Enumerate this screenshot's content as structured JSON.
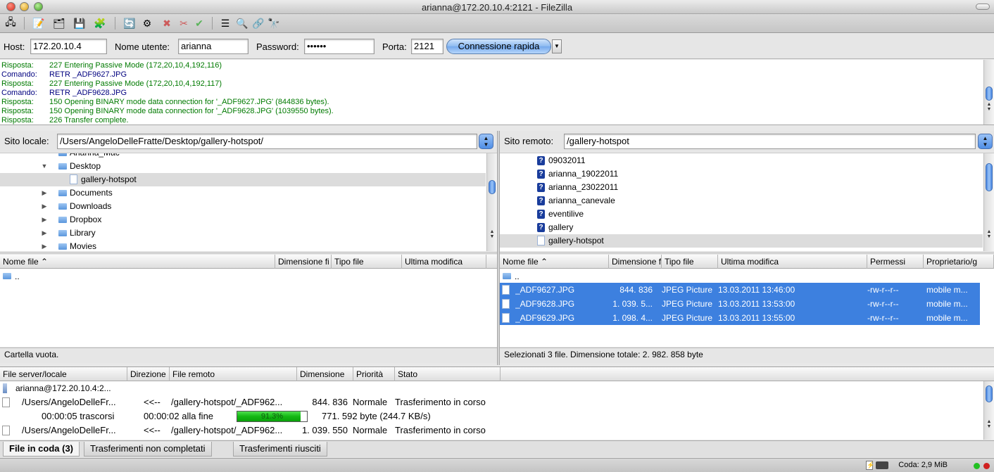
{
  "window": {
    "title": "arianna@172.20.10.4:2121 - FileZilla"
  },
  "toolbar": {
    "icons": [
      "site-manager-icon",
      "message-log-icon",
      "local-tree-icon",
      "remote-tree-icon",
      "transfer-queue-icon",
      "refresh-icon",
      "process-queue-icon",
      "cancel-icon",
      "disconnect-icon",
      "reconnect-icon",
      "filter-icon",
      "compare-icon",
      "sync-browse-icon",
      "search-icon"
    ]
  },
  "quickconnect": {
    "host_label": "Host:",
    "host_value": "172.20.10.4",
    "user_label": "Nome utente:",
    "user_value": "arianna",
    "password_label": "Password:",
    "password_value": "••••••",
    "port_label": "Porta:",
    "port_value": "2121",
    "connect_button": "Connessione rapida"
  },
  "log": [
    {
      "kind": "Risposta:",
      "type": "resp",
      "msg": "227 Entering Passive Mode (172,20,10,4,192,116)"
    },
    {
      "kind": "Comando:",
      "type": "cmd",
      "msg": "RETR _ADF9627.JPG"
    },
    {
      "kind": "Risposta:",
      "type": "resp",
      "msg": "227 Entering Passive Mode (172,20,10,4,192,117)"
    },
    {
      "kind": "Comando:",
      "type": "cmd",
      "msg": "RETR _ADF9628.JPG"
    },
    {
      "kind": "Risposta:",
      "type": "resp",
      "msg": "150 Opening BINARY mode data connection for '_ADF9627.JPG' (844836 bytes)."
    },
    {
      "kind": "Risposta:",
      "type": "resp",
      "msg": "150 Opening BINARY mode data connection for '_ADF9628.JPG' (1039550 bytes)."
    },
    {
      "kind": "Risposta:",
      "type": "resp",
      "msg": "226 Transfer complete."
    }
  ],
  "local": {
    "site_label": "Sito locale:",
    "path": "/Users/AngeloDelleFratte/Desktop/gallery-hotspot/",
    "tree": [
      {
        "name": "Arianna_Mac",
        "tri": "",
        "indent": 0
      },
      {
        "name": "Desktop",
        "tri": "▼",
        "indent": 0
      },
      {
        "name": "gallery-hotspot",
        "tri": "",
        "indent": 1,
        "selected": true
      },
      {
        "name": "Documents",
        "tri": "▶",
        "indent": 0
      },
      {
        "name": "Downloads",
        "tri": "▶",
        "indent": 0
      },
      {
        "name": "Dropbox",
        "tri": "▶",
        "indent": 0
      },
      {
        "name": "Library",
        "tri": "▶",
        "indent": 0
      },
      {
        "name": "Movies",
        "tri": "▶",
        "indent": 0
      }
    ],
    "columns": [
      "Nome file",
      "Dimensione fi",
      "Tipo file",
      "Ultima modifica"
    ],
    "rows": [
      {
        "name": ".."
      }
    ],
    "status": "Cartella vuota."
  },
  "remote": {
    "site_label": "Sito remoto:",
    "path": "/gallery-hotspot",
    "tree": [
      {
        "name": "09032011"
      },
      {
        "name": "arianna_19022011"
      },
      {
        "name": "arianna_23022011"
      },
      {
        "name": "arianna_canevale"
      },
      {
        "name": "eventilive"
      },
      {
        "name": "gallery"
      },
      {
        "name": "gallery-hotspot",
        "selected": true
      }
    ],
    "columns": [
      "Nome file",
      "Dimensione f",
      "Tipo file",
      "Ultima modifica",
      "Permessi",
      "Proprietario/g"
    ],
    "parent": "..",
    "rows": [
      {
        "name": "_ADF9627.JPG",
        "size": "844. 836",
        "type": "JPEG Picture",
        "modified": "13.03.2011 13:46:00",
        "perms": "-rw-r--r--",
        "owner": "mobile m..."
      },
      {
        "name": "_ADF9628.JPG",
        "size": "1. 039. 5...",
        "type": "JPEG Picture",
        "modified": "13.03.2011 13:53:00",
        "perms": "-rw-r--r--",
        "owner": "mobile m..."
      },
      {
        "name": "_ADF9629.JPG",
        "size": "1. 098. 4...",
        "type": "JPEG Picture",
        "modified": "13.03.2011 13:55:00",
        "perms": "-rw-r--r--",
        "owner": "mobile m..."
      }
    ],
    "status": "Selezionati 3 file. Dimensione totale: 2. 982. 858 byte"
  },
  "queue": {
    "columns": [
      "File server/locale",
      "Direzione",
      "File remoto",
      "Dimensione",
      "Priorità",
      "Stato"
    ],
    "server": "arianna@172.20.10.4:2...",
    "items": [
      {
        "local": "/Users/AngeloDelleFr...",
        "dir": "<<--",
        "remote": "/gallery-hotspot/_ADF962...",
        "size": "844. 836",
        "priority": "Normale",
        "state": "Trasferimento in corso"
      },
      {
        "local": "/Users/AngeloDelleFr...",
        "dir": "<<--",
        "remote": "/gallery-hotspot/_ADF962...",
        "size": "1. 039. 550",
        "priority": "Normale",
        "state": "Trasferimento in corso"
      }
    ],
    "progress": {
      "elapsed": "00:00:05 trascorsi",
      "remaining": "00:00:02 alla fine",
      "percent": 91.3,
      "percent_label": "91.3%",
      "bytes": "771. 592 byte (244.7 KB/s)"
    }
  },
  "tabs": [
    "File in coda (3)",
    "Trasferimenti non completati",
    "Trasferimenti riusciti"
  ],
  "bottom": {
    "queue_info": "Coda: 2,9 MiB",
    "led_colors": [
      "#22c022",
      "#d02020"
    ]
  }
}
